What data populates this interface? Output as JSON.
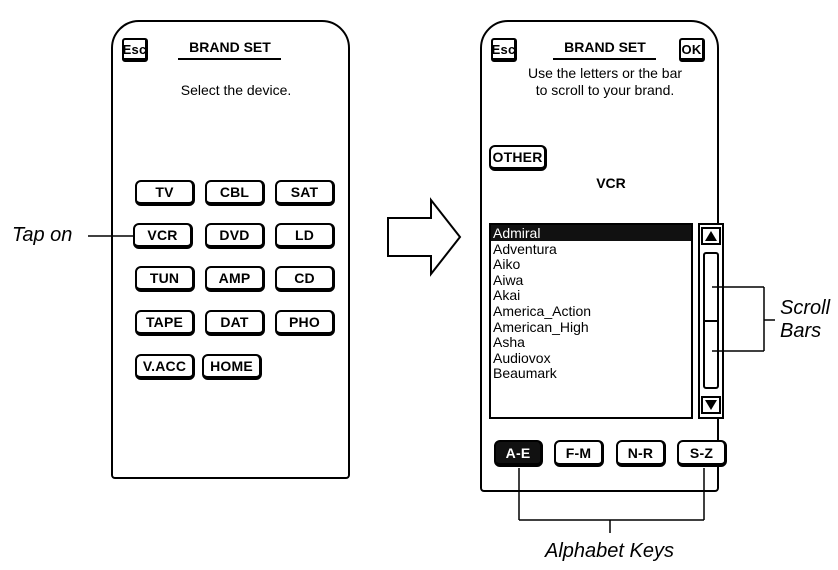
{
  "left_remote": {
    "esc": "Esc",
    "title": "BRAND SET",
    "message": "Select the device.",
    "devices": [
      "TV",
      "CBL",
      "SAT",
      "VCR",
      "DVD",
      "LD",
      "TUN",
      "AMP",
      "CD",
      "TAPE",
      "DAT",
      "PHO",
      "V.ACC",
      "HOME"
    ]
  },
  "right_remote": {
    "esc": "Esc",
    "title": "BRAND SET",
    "ok": "OK",
    "message_line1": "Use the letters or the bar",
    "message_line2": "to scroll to your brand.",
    "other": "OTHER",
    "device": "VCR",
    "brands": [
      "Admiral",
      "Adventura",
      "Aiko",
      "Aiwa",
      "Akai",
      "America_Action",
      "American_High",
      "Asha",
      "Audiovox",
      "Beaumark"
    ],
    "selected_brand": "Admiral",
    "alphabet_keys": [
      "A-E",
      "F-M",
      "N-R",
      "S-Z"
    ],
    "active_key": "A-E"
  },
  "callouts": {
    "tap_on": "Tap on",
    "scroll": "Scroll",
    "bars": "Bars",
    "alphabet_keys": "Alphabet Keys"
  }
}
